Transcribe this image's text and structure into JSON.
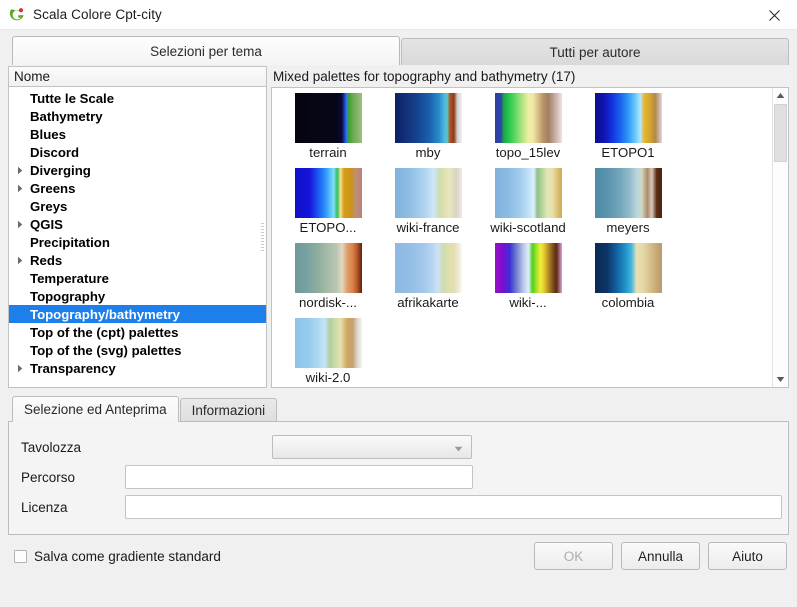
{
  "window": {
    "title": "Scala Colore Cpt-city",
    "logo_icon": "qgis-logo-icon",
    "close_icon": "close-icon"
  },
  "top_tabs": [
    {
      "label": "Selezioni per tema",
      "active": true
    },
    {
      "label": "Tutti per autore",
      "active": false
    }
  ],
  "tree": {
    "header": "Nome",
    "items": [
      {
        "label": "Tutte le Scale",
        "expandable": false,
        "selected": false
      },
      {
        "label": "Bathymetry",
        "expandable": false,
        "selected": false
      },
      {
        "label": "Blues",
        "expandable": false,
        "selected": false
      },
      {
        "label": "Discord",
        "expandable": false,
        "selected": false
      },
      {
        "label": "Diverging",
        "expandable": true,
        "selected": false
      },
      {
        "label": "Greens",
        "expandable": true,
        "selected": false
      },
      {
        "label": "Greys",
        "expandable": false,
        "selected": false
      },
      {
        "label": "QGIS",
        "expandable": true,
        "selected": false
      },
      {
        "label": "Precipitation",
        "expandable": false,
        "selected": false
      },
      {
        "label": "Reds",
        "expandable": true,
        "selected": false
      },
      {
        "label": "Temperature",
        "expandable": false,
        "selected": false
      },
      {
        "label": "Topography",
        "expandable": false,
        "selected": false
      },
      {
        "label": "Topography/bathymetry",
        "expandable": false,
        "selected": true
      },
      {
        "label": "Top of the (cpt) palettes",
        "expandable": false,
        "selected": false
      },
      {
        "label": "Top of the (svg) palettes",
        "expandable": false,
        "selected": false
      },
      {
        "label": "Transparency",
        "expandable": true,
        "selected": false
      }
    ]
  },
  "palettes": {
    "heading": "Mixed palettes for topography and bathymetry (17)",
    "scroll_up_icon": "scroll-up-icon",
    "scroll_down_icon": "scroll-down-icon",
    "items": [
      {
        "name": "terrain",
        "gradient": "linear-gradient(to right, #05050f 0%, #06061a 62%, #0a0a33 70%, #1a3fd0 74%, #2e7bd8 77%, #37a02e 80%, #6aa84f 86%, #84b36a 93%, #9bbf7f 100%)"
      },
      {
        "name": "mby",
        "gradient": "linear-gradient(to right, #0b1f66 0%, #123078 16%, #14448f 34%, #1a63ad 52%, #2a8dcc 66%, #4fb8e0 74%, #57c9c2 78%, #b0522a 82%, #8d3a18 88%, #cfcfcf 93%, #f2f2f2 100%)"
      },
      {
        "name": "topo_15lev",
        "gradient": "linear-gradient(to right, #2b3f9e 0%, #2f46a8 9%, #17a844 13%, #2ec94f 22%, #6fd96a 32%, #b4e583 41%, #eef0a0 50%, #efe6a7 57%, #d8c083 64%, #b8926a 72%, #a27f63 80%, #bda096 87%, #d7c3bb 94%, #efe4e0 100%)"
      },
      {
        "name": "ETOPO1",
        "gradient": "linear-gradient(to right, #0a0e8c 0%, #0f14b5 14%, #1334e0 26%, #1b63ef 38%, #2f9bf7 50%, #69c8fb 60%, #b5e6fd 68%, #e8b836 73%, #d4a42a 82%, #b08a4a 90%, #c9b8a8 96%, #e4d8cc 100%)"
      },
      {
        "name": "ETOPO...",
        "gradient": "linear-gradient(to right, #1010c8 0%, #1515dc 22%, #1b55f0 34%, #2a8cfb 44%, #56bdfd 52%, #7fe0f2 58%, #2fc05e 63%, #f2e38a 68%, #d89c1a 73%, #c99418 84%, #bf8f72 90%, #b8817c 100%)"
      },
      {
        "name": "wiki-france",
        "gradient": "linear-gradient(to right, #7fb2dc 0%, #8cbbe2 18%, #9fc9ea 34%, #b6d8f2 48%, #cfe8f8 58%, #cfdcb4 66%, #dce0ac 73%, #e8e6c0 82%, #d9d2c2 91%, #efeae2 100%)"
      },
      {
        "name": "wiki-scotland",
        "gradient": "linear-gradient(to right, #7fb2dc 0%, #8cbce3 20%, #a4cdee 38%, #bfe0f8 50%, #ddeffd 58%, #8fc08a 63%, #b6d49c 70%, #e0e6b6 78%, #e6e0a8 86%, #d9b96a 95%, #cfa95c 100%)"
      },
      {
        "name": "meyers",
        "gradient": "linear-gradient(to right, #4e8aa6 0%, #5b94ae 20%, #74a7bb 38%, #92bcca 52%, #b8d4de 62%, #cfd8c4 70%, #b08a66 78%, #d6c9bc 85%, #5c2c14 92%, #4a2310 100%)"
      },
      {
        "name": "nordisk-...",
        "gradient": "linear-gradient(to right, #6f9a9a 0%, #78a2a0 18%, #8fae9d 34%, #a8bca8 50%, #b9c6b2 62%, #e0d9c2 70%, #e0a06a 78%, #d9834a 86%, #b4552a 93%, #5c2208 100%)"
      },
      {
        "name": "afrikakarte",
        "gradient": "linear-gradient(to right, #8cb8e2 0%, #93bde5 22%, #a1c6ea 40%, #b4d3f0 54%, #cde2f6 64%, #cfdcae 72%, #dde0ac 80%, #e4ddb0 88%, #efead8 95%, #fbfaf4 100%)"
      },
      {
        "name": "wiki-...",
        "gradient": "linear-gradient(to right, #9b0fc4 0%, #7a0fd0 12%, #3c2fd6 22%, #6f7fd0 32%, #b9c4e8 42%, #dff0fa 50%, #4fd01e 56%, #a8e02a 62%, #f0ef3a 68%, #e0c42a 74%, #b08a2a 80%, #7a4a18 87%, #5c2a14 92%, #e0a0de 100%)"
      },
      {
        "name": "colombia",
        "gradient": "linear-gradient(to right, #0b2a52 0%, #0d3566 18%, #1360a0 32%, #1f8cc4 44%, #3fb4e0 54%, #e8e0b4 62%, #e4d8a8 72%, #d8c08a 82%, #c6a878 92%, #b89a6e 100%)"
      },
      {
        "name": "wiki-2.0",
        "gradient": "linear-gradient(to right, #8cc4e8 0%, #96cbec 20%, #abd8f2 34%, #c4e4f6 44%, #b0cfa0 52%, #cfdaa8 60%, #e4e0b0 68%, #cfa860 78%, #c4a070 86%, #dcd4cc 93%, #f6f4f2 100%)"
      }
    ]
  },
  "bottom_tabs": [
    {
      "label": "Selezione ed Anteprima",
      "active": true
    },
    {
      "label": "Informazioni",
      "active": false
    }
  ],
  "form": {
    "tavolozza_label": "Tavolozza",
    "tavolozza_value": "",
    "tavolozza_dropdown_icon": "chevron-down-icon",
    "percorso_label": "Percorso",
    "percorso_value": "",
    "licenza_label": "Licenza",
    "licenza_value": ""
  },
  "footer": {
    "checkbox_label": "Salva come gradiente standard",
    "checkbox_checked": false,
    "ok_label": "OK",
    "ok_enabled": false,
    "cancel_label": "Annulla",
    "help_label": "Aiuto"
  },
  "colors": {
    "selection_blue": "#1c7fea",
    "window_bg": "#f0f0f0",
    "panel_bg": "#f4f4f4",
    "border": "#c2c2c2"
  }
}
